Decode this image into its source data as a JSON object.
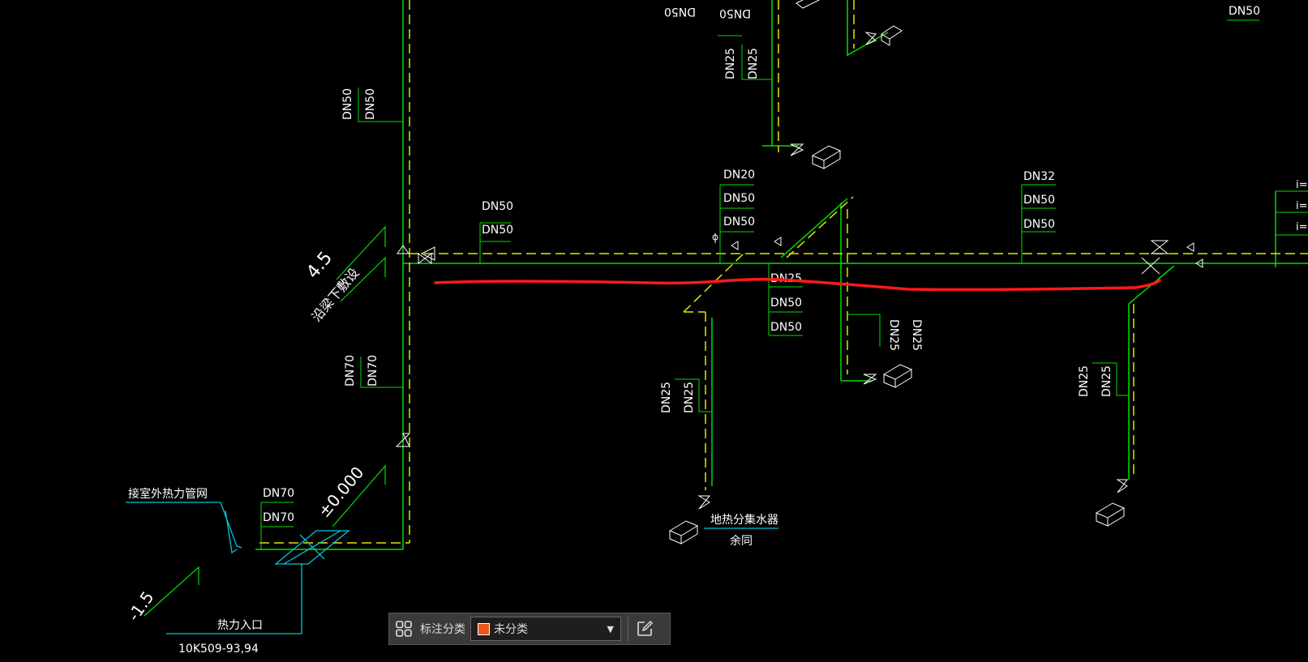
{
  "drawing": {
    "size_labels": {
      "top_rot_a": "DN50",
      "top_rot_b": "DN50",
      "right_top": "DN50",
      "v_a": "DN25",
      "v_b": "DN25",
      "left_v_a": "DN50",
      "left_v_b": "DN50",
      "b1_l1": "DN50",
      "b1_l2": "DN50",
      "b2_l1": "DN20",
      "b2_l2": "DN50",
      "b2_l3": "DN50",
      "b3_l1": "DN32",
      "b3_l2": "DN50",
      "b3_l3": "DN50",
      "mid_l1": "DN25",
      "mid_l2": "DN50",
      "mid_l3": "DN50",
      "rc_a": "DN25",
      "rc_b": "DN25",
      "low_a": "DN70",
      "low_b": "DN70",
      "bm_a": "DN25",
      "bm_b": "DN25",
      "br_a": "DN25",
      "br_b": "DN25",
      "entry_a": "DN70",
      "entry_b": "DN70"
    },
    "elevations": {
      "level_45": "4.5",
      "level_0": "±0.000",
      "level_m15": "-1.5"
    },
    "notes": {
      "beam_lay": "沿梁下敷设",
      "to_outdoor": "接室外热力管网",
      "heat_entry": "热力入口",
      "standard_ref": "10K509-93,94",
      "manifold": "地热分集水器",
      "remainder": "余同"
    },
    "slope_marks": [
      "i=",
      "i=",
      "i="
    ]
  },
  "toolbar": {
    "grid_icon": "grid-icon",
    "label": "标注分类",
    "category_value": "未分类",
    "category_color": "#e8581c",
    "edit_icon": "edit-icon"
  },
  "colors": {
    "background": "#000000",
    "pipe_supply": "#00dd00",
    "pipe_return": "#e6e600",
    "annotation": "#ffffff",
    "leader": "#00c8dc",
    "markup": "#ff1a1a"
  }
}
